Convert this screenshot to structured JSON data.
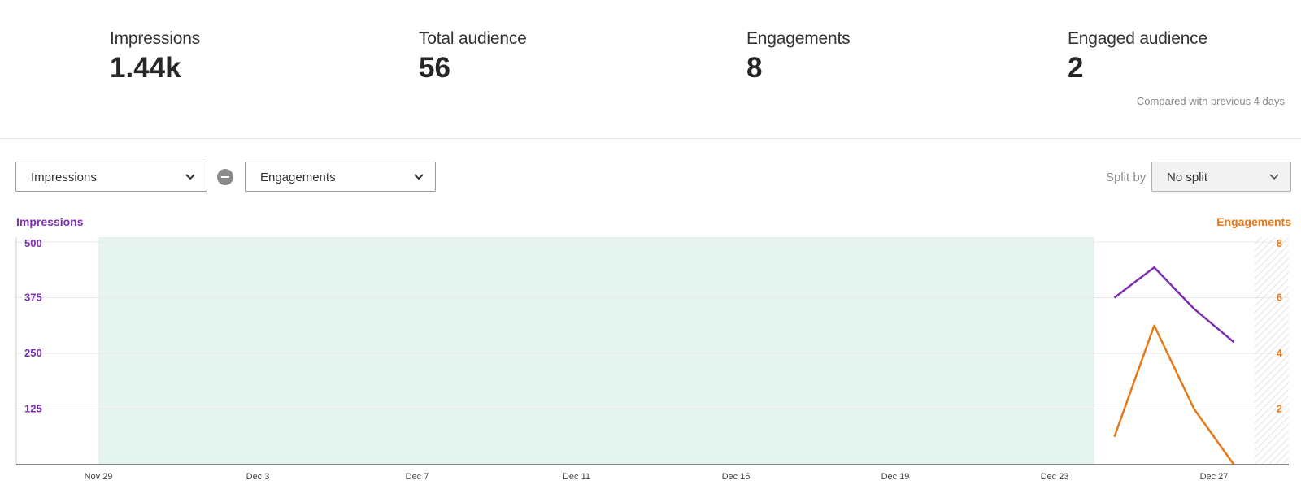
{
  "stats": [
    {
      "label": "Impressions",
      "value": "1.44k"
    },
    {
      "label": "Total audience",
      "value": "56"
    },
    {
      "label": "Engagements",
      "value": "8"
    },
    {
      "label": "Engaged audience",
      "value": "2"
    }
  ],
  "compare_note": "Compared with previous 4 days",
  "controls": {
    "metric1": "Impressions",
    "metric2": "Engagements",
    "split_label": "Split by",
    "split_value": "No split"
  },
  "colors": {
    "impressions": "#7b2fb0",
    "engagements": "#e67817",
    "highlight": "#e6f4ef"
  },
  "chart_data": {
    "type": "line",
    "x_ticks": [
      "Nov 29",
      "Dec 3",
      "Dec 7",
      "Dec 11",
      "Dec 15",
      "Dec 19",
      "Dec 23",
      "Dec 27"
    ],
    "highlight_range": [
      "Nov 29",
      "Dec 23"
    ],
    "left_axis": {
      "title": "Impressions",
      "ticks": [
        "500",
        "375",
        "250",
        "125"
      ],
      "range": [
        0,
        500
      ]
    },
    "right_axis": {
      "title": "Engagements",
      "ticks": [
        "8",
        "6",
        "4",
        "2"
      ],
      "range": [
        0,
        8
      ]
    },
    "series": [
      {
        "name": "Impressions",
        "axis": "left",
        "x": [
          "Dec 24",
          "Dec 25",
          "Dec 26",
          "Dec 27"
        ],
        "values": [
          375,
          443,
          350,
          275
        ]
      },
      {
        "name": "Engagements",
        "axis": "right",
        "x": [
          "Dec 24",
          "Dec 25",
          "Dec 26",
          "Dec 27"
        ],
        "values": [
          1,
          5,
          2,
          0
        ]
      }
    ],
    "grid": true
  }
}
